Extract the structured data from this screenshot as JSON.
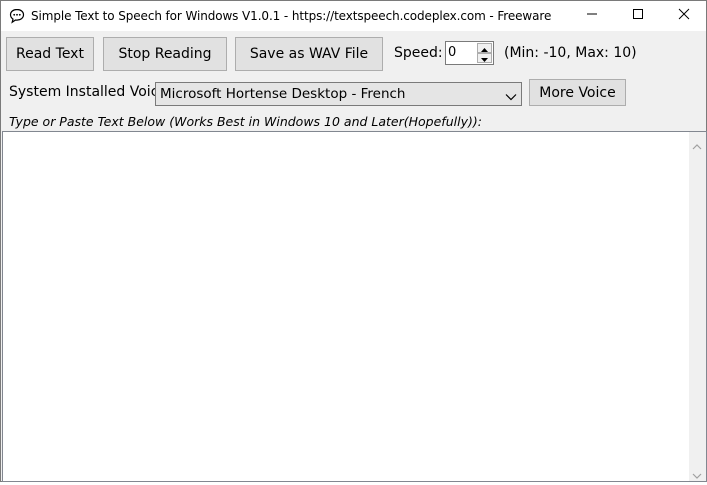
{
  "window": {
    "title": "Simple Text to Speech for Windows V1.0.1 - https://textspeech.codeplex.com - Freeware",
    "icons": {
      "app": "speech-bubble-icon",
      "minimize": "minimize-icon",
      "maximize": "maximize-icon",
      "close": "close-icon"
    }
  },
  "toolbar": {
    "read_label": "Read Text",
    "stop_label": "Stop Reading",
    "save_label": "Save as WAV File",
    "speed_label": "Speed:",
    "speed_value": "0",
    "speed_range": "(Min: -10, Max: 10)"
  },
  "voice": {
    "label": "System Installed Voice",
    "selected": "Microsoft Hortense Desktop - French",
    "more_label": "More Voice"
  },
  "editor": {
    "hint": "Type or Paste Text Below (Works Best in Windows 10 and Later(Hopefully)):",
    "content": ""
  }
}
